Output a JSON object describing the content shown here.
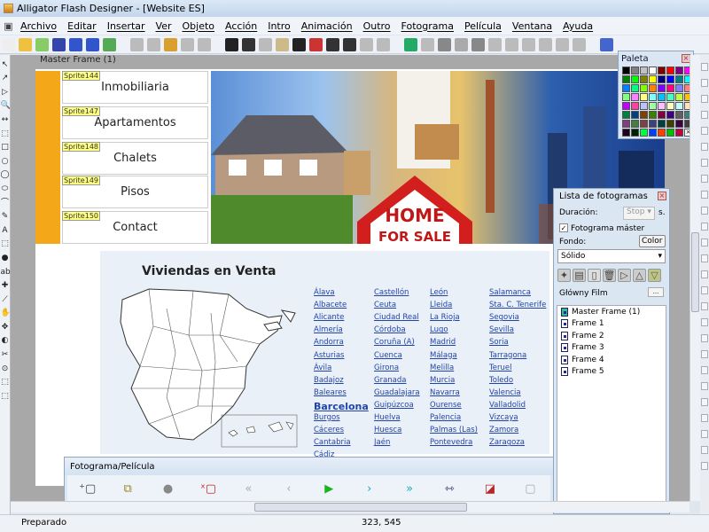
{
  "window": {
    "title": "Alligator Flash Designer - [Website ES]"
  },
  "menu": [
    "Archivo",
    "Editar",
    "Insertar",
    "Ver",
    "Objeto",
    "Acción",
    "Intro",
    "Animación",
    "Outro",
    "Fotograma",
    "Película",
    "Ventana",
    "Ayuda"
  ],
  "toolbar_icons": [
    "new-icon",
    "open-icon",
    "open-folder-icon",
    "save-icon",
    "export-icon",
    "publish-icon",
    "image-icon",
    "cut-icon",
    "copy-icon",
    "paste-icon",
    "group-icon",
    "ungroup-icon",
    "line-width-icon",
    "dropdown-icon",
    "grid-icon",
    "properties-icon",
    "text-icon",
    "shape-icon",
    "text-effect-icon",
    "text-effect2-icon",
    "fill-icon",
    "gradient-icon",
    "globe-icon",
    "hand-icon",
    "dropdown-icon",
    "action-icon",
    "dropdown-icon",
    "align-icon",
    "align2-icon",
    "align3-icon",
    "align4-icon",
    "align5-icon",
    "align6-icon",
    "help-icon"
  ],
  "left_tools": [
    "↖",
    "↗",
    "▷",
    "🔍",
    "↔",
    "⬚",
    "□",
    "○",
    "◯",
    "⬭",
    "⌒",
    "✎",
    "A",
    "⬚",
    "●",
    "abc",
    "✚",
    "⟋",
    "✋",
    "✥",
    "◐",
    "✂",
    "⊙",
    "⬚",
    "⬚"
  ],
  "canvas": {
    "frame_label": "Master Frame (1)"
  },
  "nav": [
    {
      "sprite": "Sprite144",
      "label": "Inmobiliaria"
    },
    {
      "sprite": "Sprite147",
      "label": "Apartamentos"
    },
    {
      "sprite": "Sprite148",
      "label": "Chalets"
    },
    {
      "sprite": "Sprite149",
      "label": "Pisos"
    },
    {
      "sprite": "Sprite150",
      "label": "Contact"
    }
  ],
  "banner": {
    "sign_line1": "HOME",
    "sign_line2": "FOR SALE"
  },
  "content": {
    "title": "Viviendas en Venta",
    "cities": [
      [
        "Álava",
        "Albacete",
        "Alicante",
        "Almería",
        "Andorra",
        "Asturias",
        "Ávila",
        "Badajoz",
        "Baleares",
        "Barcelona",
        "Burgos",
        "Cáceres",
        "Cantabria",
        "Cádiz"
      ],
      [
        "Castellón",
        "Ceuta",
        "Ciudad Real",
        "Córdoba",
        "Coruña (A)",
        "Cuenca",
        "Girona",
        "Granada",
        "Guadalajara",
        "Guipúzcoa",
        "Huelva",
        "Huesca",
        "Jaén"
      ],
      [
        "León",
        "Lleida",
        "La Rioja",
        "Lugo",
        "Madrid",
        "Málaga",
        "Melilla",
        "Murcia",
        "Navarra",
        "Ourense",
        "Palencia",
        "Palmas (Las)",
        "Pontevedra"
      ],
      [
        "Salamanca",
        "Sta. C. Tenerife",
        "Segovia",
        "Sevilla",
        "Soria",
        "Tarragona",
        "Teruel",
        "Toledo",
        "Valencia",
        "Valladolid",
        "Vizcaya",
        "Zamora",
        "Zaragoza"
      ]
    ],
    "highlighted_city": "Barcelona"
  },
  "frame_panel": {
    "title": "Fotograma/Película",
    "buttons": [
      {
        "icon": "add-frame-icon",
        "glyph": "⁺▢",
        "color": "#444"
      },
      {
        "icon": "frame-tree-icon",
        "glyph": "⧉",
        "color": "#998822"
      },
      {
        "icon": "record-icon",
        "glyph": "●",
        "color": "#888"
      },
      {
        "icon": "delete-frame-icon",
        "glyph": "ˣ▢",
        "color": "#c22"
      },
      {
        "icon": "first-frame-icon",
        "glyph": "«",
        "color": "#aaa"
      },
      {
        "icon": "prev-frame-icon",
        "glyph": "‹",
        "color": "#aaa"
      },
      {
        "icon": "play-icon",
        "glyph": "▶",
        "color": "#1cb41c"
      },
      {
        "icon": "next-frame-icon",
        "glyph": "›",
        "color": "#1aa8c8"
      },
      {
        "icon": "last-frame-icon",
        "glyph": "»",
        "color": "#1aa8c8"
      },
      {
        "icon": "fit-width-icon",
        "glyph": "⇿",
        "color": "#336"
      },
      {
        "icon": "fill-color-icon",
        "glyph": "◪",
        "color": "#b22"
      },
      {
        "icon": "frame-settings-icon",
        "glyph": "▢",
        "color": "#aaa"
      }
    ]
  },
  "palette": {
    "title": "Paleta",
    "colors": [
      "#000000",
      "#808080",
      "#c0c0c0",
      "#ffffff",
      "#800000",
      "#ff0000",
      "#800080",
      "#ff00ff",
      "#008000",
      "#00ff00",
      "#808000",
      "#ffff00",
      "#000080",
      "#0000ff",
      "#008080",
      "#00ffff",
      "#0080ff",
      "#00ff80",
      "#80ff00",
      "#ff8000",
      "#8000ff",
      "#ff0080",
      "#8080ff",
      "#ff8080",
      "#80ff80",
      "#ff80ff",
      "#ffff80",
      "#80ffff",
      "#00c0ff",
      "#40ffc0",
      "#c0ff40",
      "#ffc000",
      "#c000ff",
      "#ff40a0",
      "#c0c0ff",
      "#a0ffa0",
      "#ffc0ff",
      "#ffffc0",
      "#c0ffff",
      "#ffe0c0",
      "#008040",
      "#004080",
      "#804000",
      "#408000",
      "#800040",
      "#400080",
      "#606060",
      "#408080",
      "#804080",
      "#408040",
      "#804040",
      "#404080",
      "#004040",
      "#404000",
      "#400040",
      "#404040",
      "#200020",
      "#002000",
      "#00ff40",
      "#0040ff",
      "#ff4000",
      "#00c000",
      "#c00040",
      "none"
    ]
  },
  "frame_list": {
    "title": "Lista de fotogramas",
    "duration_label": "Duración:",
    "duration_value": "Stop",
    "duration_unit": "s.",
    "master_checkbox_label": "Fotograma máster",
    "master_checked": true,
    "background_label": "Fondo:",
    "color_button": "Color",
    "fill_select": "Sólido",
    "movie_label": "Główny Film",
    "movie_button": "...",
    "frames": [
      "Master Frame (1)",
      "Frame 1",
      "Frame 2",
      "Frame 3",
      "Frame 4",
      "Frame 5"
    ]
  },
  "status": {
    "text": "Preparado",
    "coords": "323, 545"
  }
}
